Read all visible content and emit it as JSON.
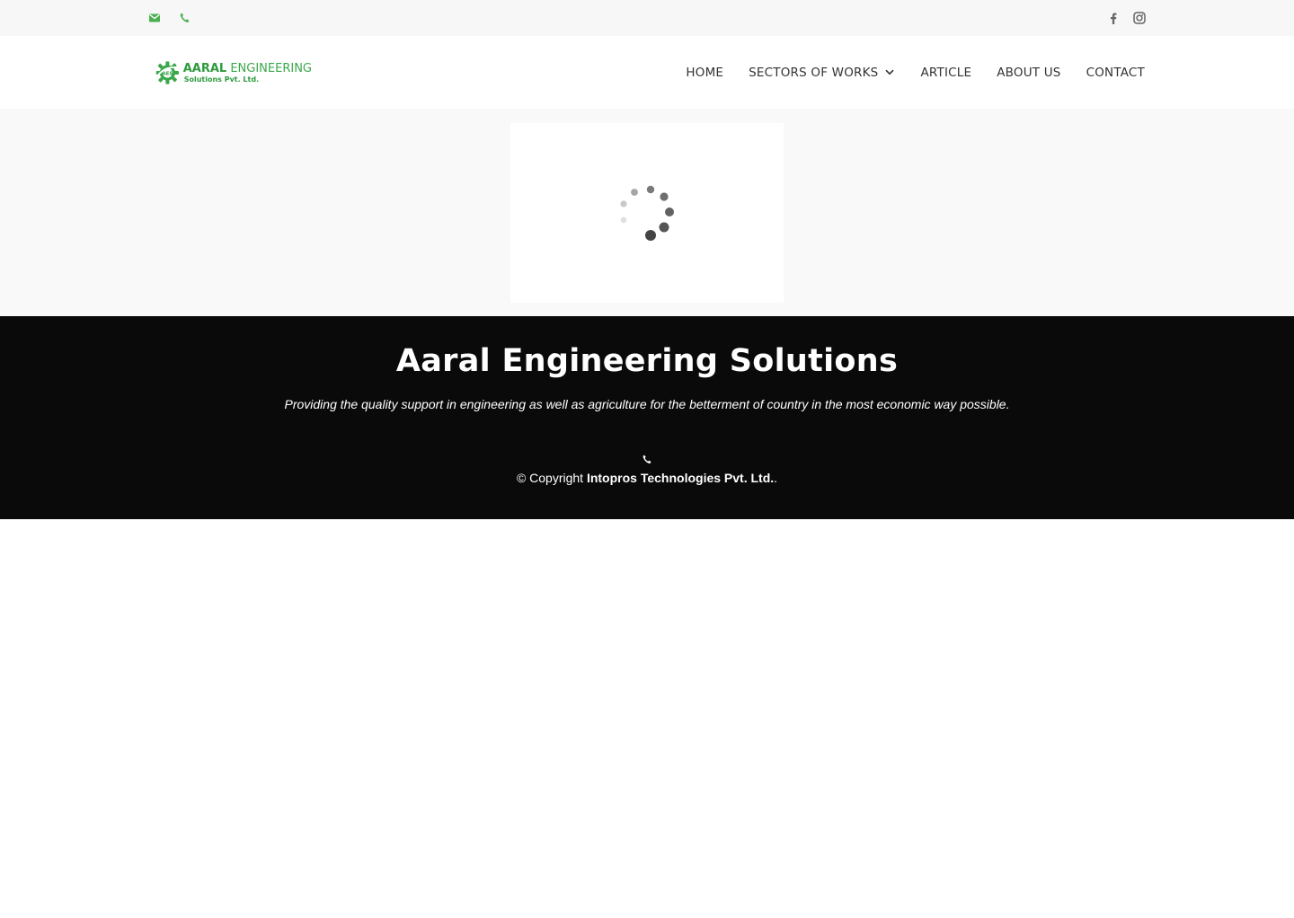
{
  "topbar": {
    "contact_icons": [
      "email-icon",
      "phone-icon"
    ],
    "social_icons": [
      "facebook-icon",
      "instagram-icon"
    ],
    "accent_color": "#4caf50"
  },
  "header": {
    "logo": {
      "badge_text": "AES",
      "name_bold": "AARAL",
      "name_light": "ENGINEERING",
      "sub": "Solutions Pvt. Ltd.",
      "color": "#2e9b3f"
    },
    "nav": [
      {
        "label": "HOME"
      },
      {
        "label": "SECTORS OF WORKS",
        "has_dropdown": true
      },
      {
        "label": "ARTICLE"
      },
      {
        "label": "ABOUT US"
      },
      {
        "label": "CONTACT"
      }
    ]
  },
  "hero": {
    "loading_icon": "spinner-icon"
  },
  "footer": {
    "title": "Aaral Engineering Solutions",
    "tagline": "Providing the quality support in engineering as well as agriculture for the betterment of country in the most economic way possible.",
    "copyright_prefix": "© Copyright ",
    "company": "Intopros Technologies Pvt. Ltd.",
    "copyright_suffix": ".",
    "background": "#0a0a0a"
  }
}
